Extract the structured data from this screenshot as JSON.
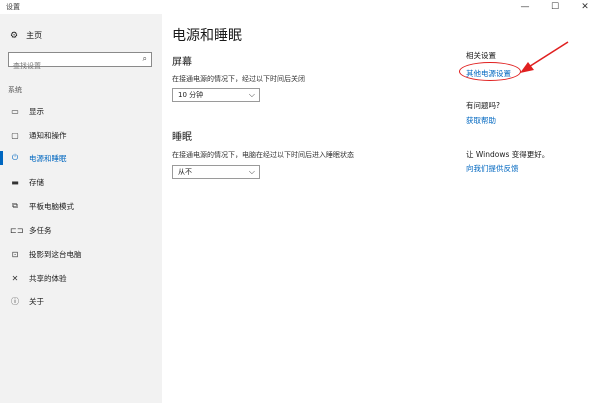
{
  "window": {
    "title": "设置",
    "minimize": "—",
    "maximize": "☐",
    "close": "✕"
  },
  "sidebar": {
    "home": "主页",
    "search_placeholder": "查找设置",
    "section": "系统",
    "items": [
      {
        "label": "显示",
        "icon": "monitor-icon"
      },
      {
        "label": "通知和操作",
        "icon": "message-icon"
      },
      {
        "label": "电源和睡眠",
        "icon": "power-icon",
        "active": true
      },
      {
        "label": "存储",
        "icon": "storage-icon"
      },
      {
        "label": "平板电脑模式",
        "icon": "tablet-icon"
      },
      {
        "label": "多任务",
        "icon": "multitask-icon"
      },
      {
        "label": "投影到这台电脑",
        "icon": "project-icon"
      },
      {
        "label": "共享的体验",
        "icon": "share-icon"
      },
      {
        "label": "关于",
        "icon": "info-icon"
      }
    ]
  },
  "main": {
    "title": "电源和睡眠",
    "screen": {
      "heading": "屏幕",
      "desc": "在接通电源的情况下，经过以下时间后关闭",
      "value": "10 分钟"
    },
    "sleep": {
      "heading": "睡眠",
      "desc": "在接通电源的情况下，电脑在经过以下时间后进入睡眠状态",
      "value": "从不"
    }
  },
  "related": {
    "title": "相关设置",
    "link": "其他电源设置",
    "question": "有问题吗?",
    "help": "获取帮助",
    "improve": "让 Windows 变得更好。",
    "feedback": "向我们提供反馈"
  },
  "colors": {
    "accent": "#0067c0",
    "annotation": "#e02020",
    "sidebar_bg": "#f2f2f2"
  }
}
